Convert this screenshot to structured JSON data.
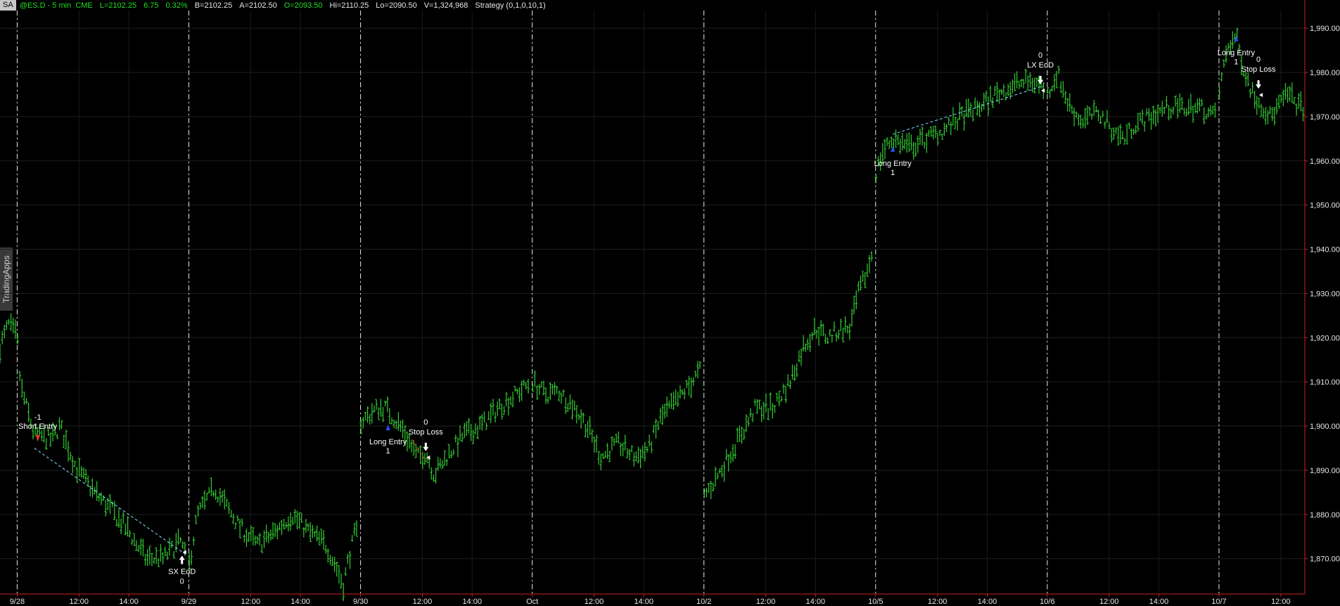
{
  "header": {
    "symbol_button": "SA",
    "fields": [
      "@ES.D - 5 min  CME",
      "L=2102.25",
      "6.75",
      "0.32%",
      "B=2102.25",
      "A=2102.50",
      "O=2093.50",
      "Hi=2110.25",
      "Lo=2090.50",
      "V=1,324,968"
    ],
    "strategy": "Strategy (0,1,0,10,1)"
  },
  "side_tab": "TradingApps",
  "colors": {
    "bars": "#33cc33",
    "axis": "#cc2222",
    "separator": "#e8e8e8",
    "long_marker": "#2255ff",
    "short_marker": "#ff3333",
    "trade_line": "#7fe0ff",
    "loss_line": "#ff3333"
  },
  "chart_data": {
    "type": "bar",
    "title": "",
    "ylim": [
      1862,
      1994
    ],
    "yticks": [
      1870,
      1880,
      1890,
      1900,
      1910,
      1920,
      1930,
      1940,
      1950,
      1960,
      1970,
      1980,
      1990
    ],
    "ytick_labels": [
      "1,870.00",
      "1,880.00",
      "1,890.00",
      "1,900.00",
      "1,910.00",
      "1,920.00",
      "1,930.00",
      "1,940.00",
      "1,950.00",
      "1,960.00",
      "1,970.00",
      "1,980.00",
      "1,990.00"
    ],
    "xlim": [
      -0.1,
      7.5
    ],
    "day_separators": [
      0,
      1,
      2,
      3,
      4,
      5,
      6,
      7
    ],
    "xticks": [
      {
        "x": 0.0,
        "label": "9/28"
      },
      {
        "x": 0.36,
        "label": "12:00"
      },
      {
        "x": 0.65,
        "label": "14:00"
      },
      {
        "x": 1.0,
        "label": "9/29"
      },
      {
        "x": 1.36,
        "label": "12:00"
      },
      {
        "x": 1.65,
        "label": "14:00"
      },
      {
        "x": 2.0,
        "label": "9/30"
      },
      {
        "x": 2.36,
        "label": "12:00"
      },
      {
        "x": 2.65,
        "label": "14:00"
      },
      {
        "x": 3.0,
        "label": "Oct"
      },
      {
        "x": 3.36,
        "label": "12:00"
      },
      {
        "x": 3.65,
        "label": "14:00"
      },
      {
        "x": 4.0,
        "label": "10/2"
      },
      {
        "x": 4.36,
        "label": "12:00"
      },
      {
        "x": 4.65,
        "label": "14:00"
      },
      {
        "x": 5.0,
        "label": "10/5"
      },
      {
        "x": 5.36,
        "label": "12:00"
      },
      {
        "x": 5.65,
        "label": "14:00"
      },
      {
        "x": 6.0,
        "label": "10/6"
      },
      {
        "x": 6.36,
        "label": "12:00"
      },
      {
        "x": 6.65,
        "label": "14:00"
      },
      {
        "x": 7.0,
        "label": "10/7"
      },
      {
        "x": 7.36,
        "label": "12:00"
      }
    ],
    "bars_per_day": 78,
    "price_path": [
      [
        -0.1,
        1918
      ],
      [
        -0.05,
        1923
      ],
      [
        0.0,
        1920
      ],
      [
        0.02,
        1909
      ],
      [
        0.1,
        1898
      ],
      [
        0.2,
        1897
      ],
      [
        0.25,
        1900
      ],
      [
        0.35,
        1890
      ],
      [
        0.45,
        1885
      ],
      [
        0.55,
        1881
      ],
      [
        0.65,
        1876
      ],
      [
        0.75,
        1870
      ],
      [
        0.85,
        1870
      ],
      [
        0.95,
        1874
      ],
      [
        1.0,
        1868
      ],
      [
        1.05,
        1880
      ],
      [
        1.15,
        1886
      ],
      [
        1.3,
        1877
      ],
      [
        1.4,
        1873
      ],
      [
        1.5,
        1876
      ],
      [
        1.6,
        1880
      ],
      [
        1.7,
        1876
      ],
      [
        1.8,
        1873
      ],
      [
        1.86,
        1868
      ],
      [
        1.9,
        1864
      ],
      [
        1.93,
        1870
      ],
      [
        1.97,
        1876
      ],
      [
        2.0,
        1875
      ],
      [
        2.0,
        1901
      ],
      [
        2.1,
        1904
      ],
      [
        2.15,
        1904
      ],
      [
        2.25,
        1899
      ],
      [
        2.33,
        1893
      ],
      [
        2.38,
        1894
      ],
      [
        2.43,
        1889
      ],
      [
        2.5,
        1893
      ],
      [
        2.6,
        1898
      ],
      [
        2.7,
        1900
      ],
      [
        2.8,
        1904
      ],
      [
        2.93,
        1908
      ],
      [
        3.0,
        1910
      ],
      [
        3.08,
        1907
      ],
      [
        3.15,
        1908
      ],
      [
        3.25,
        1904
      ],
      [
        3.32,
        1900
      ],
      [
        3.4,
        1893
      ],
      [
        3.5,
        1896
      ],
      [
        3.6,
        1893
      ],
      [
        3.68,
        1895
      ],
      [
        3.75,
        1902
      ],
      [
        3.85,
        1906
      ],
      [
        3.95,
        1911
      ],
      [
        4.0,
        1914
      ],
      [
        4.0,
        1884
      ],
      [
        4.1,
        1890
      ],
      [
        4.2,
        1897
      ],
      [
        4.3,
        1904
      ],
      [
        4.4,
        1904
      ],
      [
        4.5,
        1910
      ],
      [
        4.58,
        1918
      ],
      [
        4.65,
        1922
      ],
      [
        4.72,
        1920
      ],
      [
        4.8,
        1922
      ],
      [
        4.85,
        1922
      ],
      [
        4.9,
        1930
      ],
      [
        4.95,
        1935
      ],
      [
        5.0,
        1942
      ],
      [
        5.0,
        1957
      ],
      [
        5.04,
        1962
      ],
      [
        5.1,
        1965
      ],
      [
        5.2,
        1963
      ],
      [
        5.3,
        1965
      ],
      [
        5.4,
        1967
      ],
      [
        5.5,
        1970
      ],
      [
        5.6,
        1972
      ],
      [
        5.7,
        1975
      ],
      [
        5.8,
        1977
      ],
      [
        5.9,
        1978
      ],
      [
        5.97,
        1977
      ],
      [
        6.0,
        1975
      ],
      [
        6.06,
        1980
      ],
      [
        6.12,
        1973
      ],
      [
        6.2,
        1969
      ],
      [
        6.3,
        1971
      ],
      [
        6.38,
        1967
      ],
      [
        6.45,
        1965
      ],
      [
        6.5,
        1968
      ],
      [
        6.6,
        1970
      ],
      [
        6.7,
        1972
      ],
      [
        6.8,
        1972
      ],
      [
        6.9,
        1972
      ],
      [
        6.97,
        1970
      ],
      [
        7.0,
        1975
      ],
      [
        7.05,
        1986
      ],
      [
        7.1,
        1988
      ],
      [
        7.15,
        1980
      ],
      [
        7.2,
        1975
      ],
      [
        7.3,
        1970
      ],
      [
        7.4,
        1975
      ],
      [
        7.48,
        1972
      ]
    ],
    "annotations": [
      {
        "x": 0.12,
        "y": 1897,
        "kind": "short",
        "lines": [
          "-1",
          "Short Entry"
        ],
        "dir": "down"
      },
      {
        "x": 0.96,
        "y": 1871,
        "kind": "exit-up",
        "lines": [
          "SX EoD",
          "0"
        ]
      },
      {
        "x": 2.16,
        "y": 1900,
        "kind": "long",
        "lines": [
          "Long Entry",
          "1"
        ]
      },
      {
        "x": 2.38,
        "y": 1894,
        "kind": "exit-down",
        "lines": [
          "0",
          "Stop Loss"
        ]
      },
      {
        "x": 5.1,
        "y": 1963,
        "kind": "long",
        "lines": [
          "Long Entry",
          "1"
        ]
      },
      {
        "x": 5.96,
        "y": 1977,
        "kind": "exit-down",
        "lines": [
          "0",
          "LX EoD"
        ]
      },
      {
        "x": 7.1,
        "y": 1988,
        "kind": "long",
        "lines": [
          "Long Entry",
          "1"
        ]
      },
      {
        "x": 7.23,
        "y": 1976,
        "kind": "exit-down",
        "lines": [
          "0",
          "Stop Loss"
        ]
      }
    ],
    "trade_lines": [
      {
        "from": [
          0.1,
          1895
        ],
        "to": [
          0.98,
          1871
        ],
        "color": "trade"
      },
      {
        "from": [
          2.3,
          1897
        ],
        "to": [
          2.38,
          1892
        ],
        "color": "loss"
      },
      {
        "from": [
          5.1,
          1966
        ],
        "to": [
          5.98,
          1977
        ],
        "color": "trade"
      }
    ]
  }
}
